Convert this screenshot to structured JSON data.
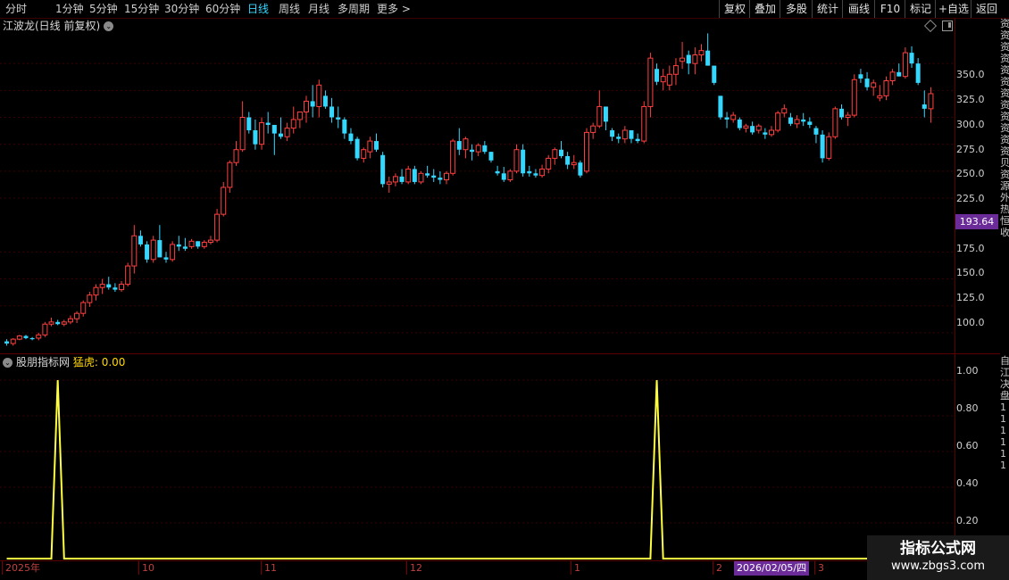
{
  "toolbar": {
    "periods": [
      "分时",
      "1分钟",
      "5分钟",
      "15分钟",
      "30分钟",
      "60分钟",
      "日线",
      "周线",
      "月线",
      "多周期",
      "更多 >"
    ],
    "active": "日线",
    "actions": [
      "复权",
      "叠加",
      "多股",
      "统计",
      "画线",
      "F10",
      "标记",
      "+自选",
      "返回"
    ]
  },
  "main_chart": {
    "title": "江波龙(日线 前复权)",
    "current_price": "193.64",
    "y_axis_labels": [
      "350.0",
      "325.0",
      "300.0",
      "275.0",
      "250.0",
      "225.0",
      "175.0",
      "150.0",
      "125.0",
      "100.0"
    ],
    "right_edge_text": "资资资资资资资资资资资资贝资源外热恒收"
  },
  "indicator": {
    "name": "股朋指标网",
    "series_label": "猛虎:",
    "series_value": "0.00",
    "y_axis_labels": [
      "1.00",
      "0.80",
      "0.60",
      "0.40",
      "0.20"
    ],
    "right_edge_text": "自江决盘111111"
  },
  "date_axis": {
    "labels": [
      "2025年",
      "10",
      "11",
      "12",
      "1",
      "2",
      "3"
    ],
    "highlight": "2026/02/05/四"
  },
  "watermark": {
    "line1": "指标公式网",
    "line2": "www.zbgs3.com"
  },
  "colors": {
    "up": "#ff4040",
    "down": "#34d8ff",
    "indicator_line": "#ffff40",
    "background": "#000000"
  },
  "chart_data": [
    {
      "type": "candlestick",
      "title": "江波龙(日线 前复权)",
      "ylim": [
        85,
        375
      ],
      "ohlc": [
        [
          92,
          94,
          88,
          90
        ],
        [
          90,
          95,
          88,
          94
        ],
        [
          94,
          98,
          93,
          97
        ],
        [
          97,
          98,
          94,
          95
        ],
        [
          95,
          96,
          93,
          94
        ],
        [
          95,
          100,
          93,
          98
        ],
        [
          98,
          110,
          96,
          108
        ],
        [
          108,
          114,
          106,
          110
        ],
        [
          110,
          112,
          107,
          108
        ],
        [
          108,
          112,
          106,
          110
        ],
        [
          110,
          116,
          108,
          113
        ],
        [
          113,
          120,
          109,
          118
        ],
        [
          118,
          130,
          115,
          128
        ],
        [
          128,
          138,
          124,
          135
        ],
        [
          135,
          145,
          130,
          142
        ],
        [
          142,
          150,
          136,
          145
        ],
        [
          145,
          152,
          140,
          142
        ],
        [
          142,
          146,
          138,
          140
        ],
        [
          140,
          148,
          138,
          145
        ],
        [
          145,
          165,
          143,
          162
        ],
        [
          162,
          200,
          155,
          190
        ],
        [
          190,
          195,
          180,
          182
        ],
        [
          182,
          185,
          165,
          168
        ],
        [
          168,
          190,
          165,
          186
        ],
        [
          186,
          200,
          180,
          170
        ],
        [
          170,
          175,
          165,
          168
        ],
        [
          168,
          185,
          166,
          182
        ],
        [
          182,
          190,
          176,
          180
        ],
        [
          180,
          188,
          176,
          178
        ],
        [
          180,
          187,
          178,
          185
        ],
        [
          185,
          182,
          178,
          180
        ],
        [
          180,
          186,
          178,
          184
        ],
        [
          184,
          190,
          182,
          186
        ],
        [
          186,
          215,
          184,
          210
        ],
        [
          210,
          240,
          208,
          235
        ],
        [
          235,
          260,
          230,
          258
        ],
        [
          258,
          278,
          255,
          270
        ],
        [
          270,
          315,
          268,
          300
        ],
        [
          300,
          305,
          285,
          288
        ],
        [
          288,
          298,
          270,
          275
        ],
        [
          275,
          300,
          270,
          295
        ],
        [
          295,
          305,
          285,
          293
        ],
        [
          293,
          280,
          265,
          285
        ],
        [
          285,
          300,
          280,
          282
        ],
        [
          282,
          295,
          278,
          290
        ],
        [
          290,
          310,
          285,
          298
        ],
        [
          298,
          305,
          290,
          305
        ],
        [
          305,
          320,
          295,
          315
        ],
        [
          315,
          330,
          300,
          310
        ],
        [
          310,
          335,
          300,
          330
        ],
        [
          320,
          325,
          308,
          310
        ],
        [
          310,
          318,
          295,
          300
        ],
        [
          300,
          310,
          290,
          298
        ],
        [
          298,
          300,
          280,
          285
        ],
        [
          285,
          290,
          275,
          278
        ],
        [
          280,
          282,
          260,
          262
        ],
        [
          262,
          272,
          258,
          270
        ],
        [
          268,
          282,
          262,
          278
        ],
        [
          278,
          285,
          268,
          270
        ],
        [
          265,
          268,
          235,
          238
        ],
        [
          238,
          245,
          230,
          240
        ],
        [
          240,
          248,
          236,
          245
        ],
        [
          245,
          252,
          238,
          240
        ],
        [
          240,
          255,
          238,
          252
        ],
        [
          252,
          255,
          238,
          240
        ],
        [
          240,
          250,
          238,
          248
        ],
        [
          248,
          255,
          244,
          246
        ],
        [
          246,
          252,
          240,
          244
        ],
        [
          244,
          250,
          238,
          242
        ],
        [
          242,
          250,
          238,
          248
        ],
        [
          248,
          280,
          246,
          278
        ],
        [
          278,
          290,
          265,
          270
        ],
        [
          270,
          282,
          262,
          280
        ],
        [
          270,
          275,
          260,
          268
        ],
        [
          268,
          276,
          264,
          274
        ],
        [
          274,
          278,
          266,
          268
        ],
        [
          268,
          262,
          258,
          260
        ],
        [
          250,
          255,
          246,
          248
        ],
        [
          248,
          254,
          240,
          242
        ],
        [
          242,
          252,
          240,
          250
        ],
        [
          250,
          275,
          248,
          270
        ],
        [
          270,
          275,
          245,
          248
        ],
        [
          250,
          255,
          245,
          248
        ],
        [
          248,
          252,
          244,
          246
        ],
        [
          246,
          256,
          244,
          252
        ],
        [
          252,
          265,
          248,
          262
        ],
        [
          262,
          272,
          256,
          270
        ],
        [
          270,
          278,
          262,
          264
        ],
        [
          264,
          268,
          252,
          256
        ],
        [
          256,
          265,
          252,
          258
        ],
        [
          258,
          260,
          244,
          246
        ],
        [
          250,
          290,
          248,
          286
        ],
        [
          286,
          295,
          280,
          292
        ],
        [
          292,
          325,
          290,
          310
        ],
        [
          310,
          300,
          288,
          296
        ],
        [
          288,
          290,
          278,
          282
        ],
        [
          282,
          285,
          276,
          280
        ],
        [
          280,
          292,
          276,
          288
        ],
        [
          288,
          282,
          276,
          280
        ],
        [
          280,
          285,
          276,
          278
        ],
        [
          278,
          315,
          276,
          310
        ],
        [
          310,
          360,
          300,
          355
        ],
        [
          345,
          350,
          330,
          333
        ],
        [
          333,
          345,
          325,
          338
        ],
        [
          330,
          348,
          325,
          340
        ],
        [
          340,
          355,
          330,
          348
        ],
        [
          352,
          370,
          345,
          355
        ],
        [
          358,
          362,
          340,
          350
        ],
        [
          350,
          365,
          340,
          358
        ],
        [
          358,
          368,
          352,
          362
        ],
        [
          362,
          378,
          355,
          348
        ],
        [
          348,
          345,
          330,
          332
        ],
        [
          320,
          320,
          298,
          300
        ],
        [
          300,
          305,
          290,
          298
        ],
        [
          298,
          305,
          295,
          302
        ],
        [
          298,
          300,
          288,
          290
        ],
        [
          290,
          294,
          286,
          292
        ],
        [
          292,
          296,
          284,
          286
        ],
        [
          288,
          294,
          285,
          292
        ],
        [
          286,
          290,
          280,
          284
        ],
        [
          284,
          292,
          282,
          288
        ],
        [
          288,
          306,
          286,
          304
        ],
        [
          304,
          312,
          300,
          308
        ],
        [
          300,
          304,
          292,
          294
        ],
        [
          294,
          302,
          290,
          298
        ],
        [
          298,
          304,
          292,
          296
        ],
        [
          296,
          300,
          290,
          293
        ],
        [
          290,
          292,
          276,
          284
        ],
        [
          284,
          288,
          258,
          262
        ],
        [
          262,
          286,
          260,
          282
        ],
        [
          282,
          310,
          280,
          308
        ],
        [
          308,
          312,
          298,
          300
        ],
        [
          300,
          305,
          292,
          302
        ],
        [
          302,
          340,
          300,
          335
        ],
        [
          340,
          345,
          332,
          336
        ],
        [
          336,
          342,
          325,
          328
        ],
        [
          328,
          335,
          320,
          332
        ],
        [
          318,
          330,
          315,
          320
        ],
        [
          320,
          338,
          316,
          334
        ],
        [
          334,
          345,
          330,
          342
        ],
        [
          342,
          350,
          338,
          338
        ],
        [
          338,
          365,
          336,
          360
        ],
        [
          360,
          366,
          346,
          350
        ],
        [
          350,
          355,
          330,
          332
        ],
        [
          312,
          325,
          300,
          308
        ],
        [
          308,
          328,
          295,
          322
        ]
      ]
    },
    {
      "type": "line",
      "name": "猛虎",
      "ylim": [
        0,
        1.05
      ],
      "values_note_index_count": 142,
      "spikes": [
        {
          "index": 8,
          "value": 1.0
        },
        {
          "index": 102,
          "value": 1.0
        }
      ],
      "baseline": 0.0
    }
  ]
}
